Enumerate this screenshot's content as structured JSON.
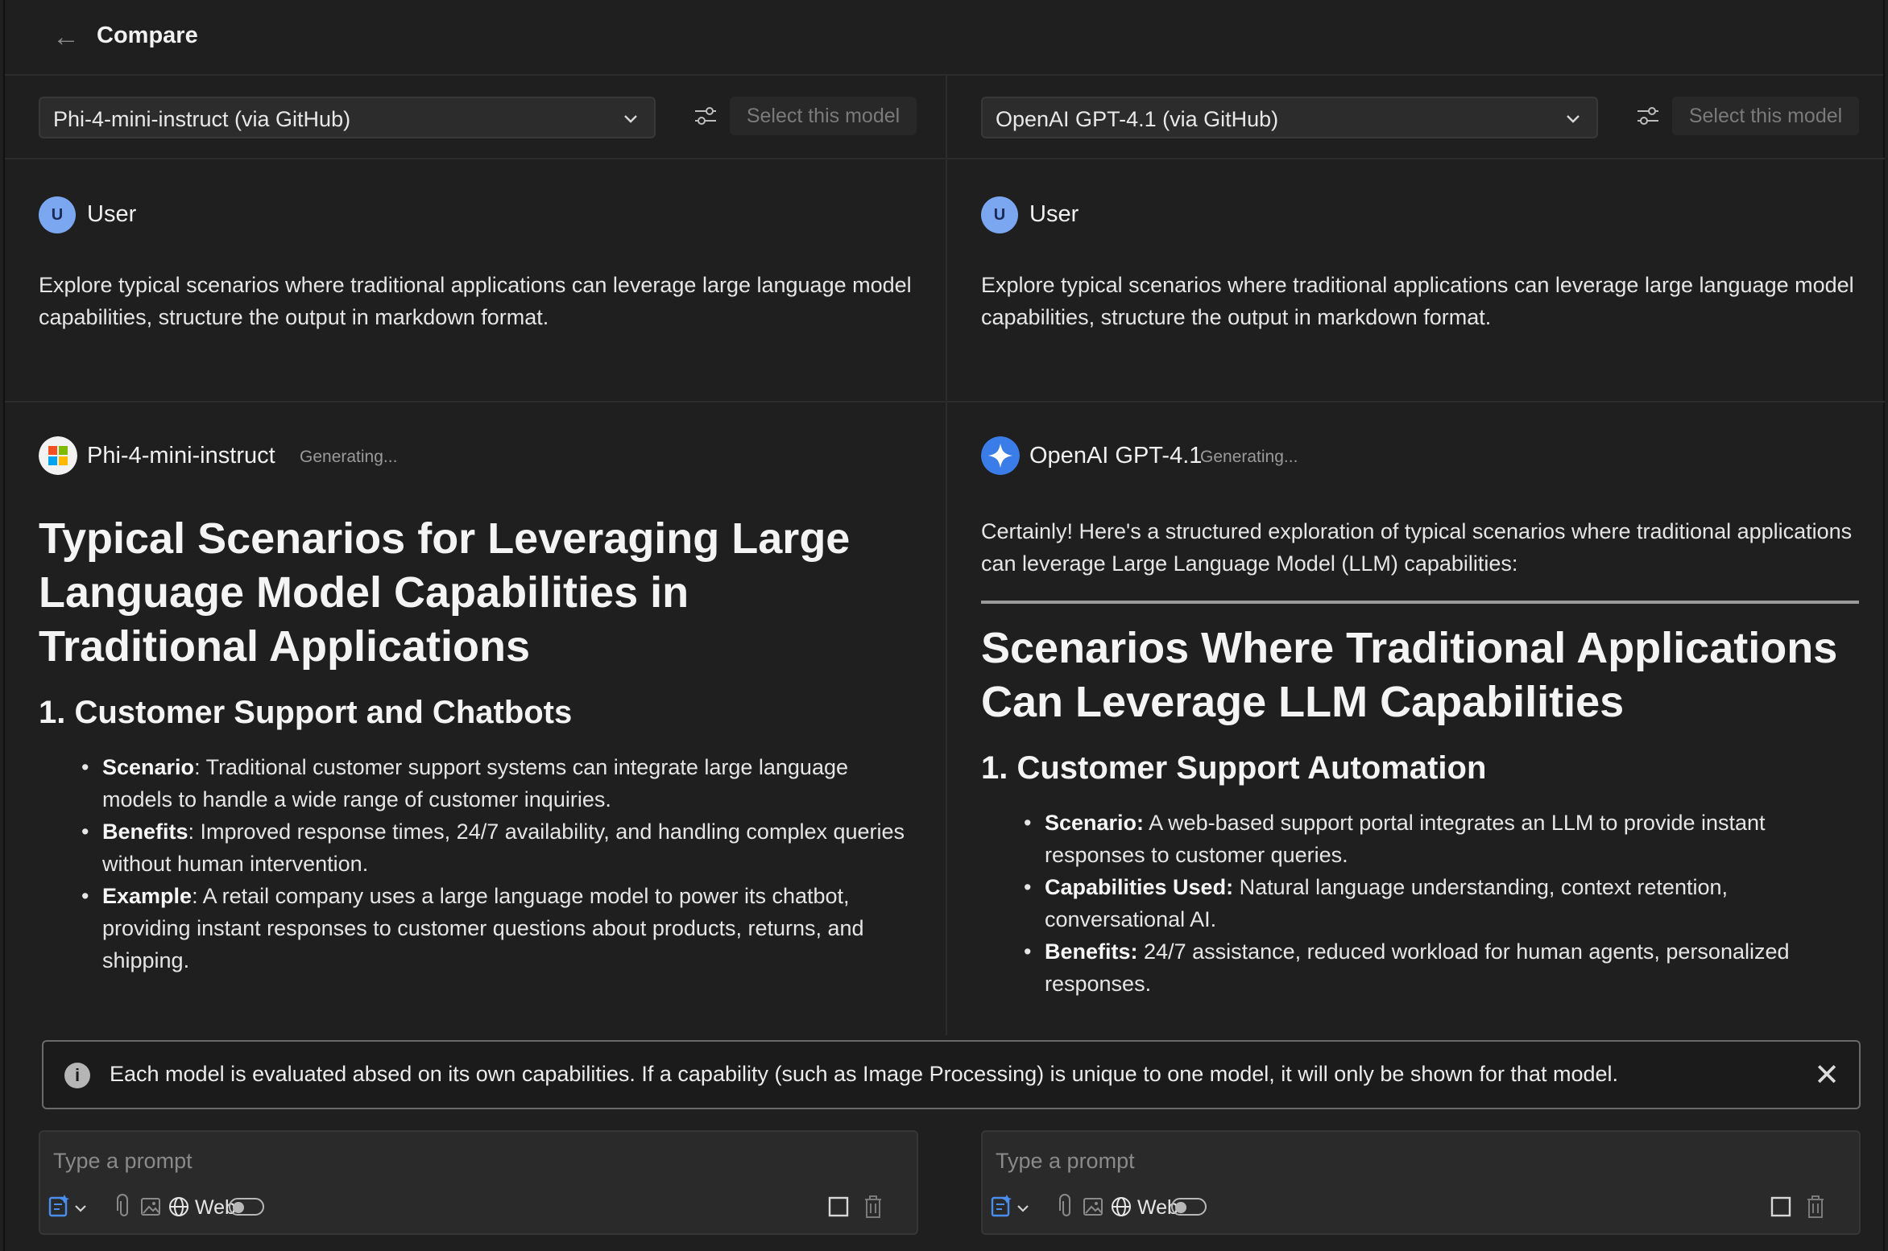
{
  "header": {
    "title": "Compare",
    "back_icon": "arrow-left-icon"
  },
  "columns": [
    {
      "model_select": "Phi-4-mini-instruct (via GitHub)",
      "select_button": "Select this model",
      "user": {
        "avatar": "U",
        "name": "User",
        "prompt": "Explore typical scenarios where traditional applications can leverage large language model capabilities, structure the output in markdown format."
      },
      "response": {
        "model_name": "Phi-4-mini-instruct",
        "status": "Generating...",
        "logo": "microsoft-logo-icon",
        "h1": "Typical Scenarios for Leveraging Large Language Model Capabilities in Traditional Applications",
        "h2": "1. Customer Support and Chatbots",
        "items": [
          {
            "label": "Scenario",
            "sep": ": ",
            "text": "Traditional customer support systems can integrate large language models to handle a wide range of customer inquiries."
          },
          {
            "label": "Benefits",
            "sep": ": ",
            "text": "Improved response times, 24/7 availability, and handling complex queries without human intervention."
          },
          {
            "label": "Example",
            "sep": ": ",
            "text": "A retail company uses a large language model to power its chatbot, providing instant responses to customer questions about products, returns, and shipping."
          }
        ]
      },
      "composer": {
        "placeholder": "Type a prompt",
        "web_label": "Web"
      }
    },
    {
      "model_select": "OpenAI GPT-4.1 (via GitHub)",
      "select_button": "Select this model",
      "user": {
        "avatar": "U",
        "name": "User",
        "prompt": "Explore typical scenarios where traditional applications can leverage large language model capabilities, structure the output in markdown format."
      },
      "response": {
        "model_name": "OpenAI GPT-4.1",
        "status": "Generating...",
        "logo": "openai-sparkle-icon",
        "intro": "Certainly! Here's a structured exploration of typical scenarios where traditional applications can leverage Large Language Model (LLM) capabilities:",
        "h1": "Scenarios Where Traditional Applications Can Leverage LLM Capabilities",
        "h2": "1. Customer Support Automation",
        "items": [
          {
            "label": "Scenario:",
            "sep": " ",
            "text": "A web-based support portal integrates an LLM to provide instant responses to customer queries."
          },
          {
            "label": "Capabilities Used:",
            "sep": " ",
            "text": "Natural language understanding, context retention, conversational AI."
          },
          {
            "label": "Benefits:",
            "sep": " ",
            "text": "24/7 assistance, reduced workload for human agents, personalized responses."
          }
        ]
      },
      "composer": {
        "placeholder": "Type a prompt",
        "web_label": "Web"
      }
    }
  ],
  "banner": {
    "message": "Each model is evaluated absed on its own capabilities. If a capability (such as Image Processing) is unique to one model, it will only be shown for that model.",
    "icon": "info-icon"
  },
  "colors": {
    "background": "#1f1f1f",
    "panel": "#2a2a2a",
    "user_avatar": "#7aa7f0",
    "border": "#2c2c2c"
  }
}
